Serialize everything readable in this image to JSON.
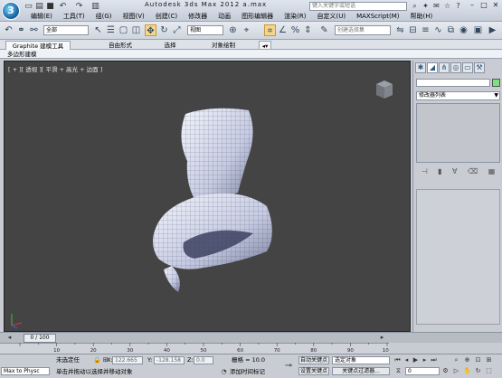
{
  "app": {
    "logo_glyph": "3",
    "title": "Autodesk 3ds Max  2012      a.max",
    "search_placeholder": "键入关键字或短语"
  },
  "menus": [
    "编辑(E)",
    "工具(T)",
    "组(G)",
    "视图(V)",
    "创建(C)",
    "修改器",
    "动画",
    "图形编辑器",
    "渲染(R)",
    "自定义(U)",
    "MAXScript(M)",
    "帮助(H)"
  ],
  "toolbar": {
    "selection_filter": "全部",
    "reference_coord": "视图",
    "named_selection": "创建选择集"
  },
  "ribbon": {
    "tabs": [
      "Graphite 建模工具",
      "自由形式",
      "选择",
      "对象绘制"
    ],
    "sub_label": "多边形建模"
  },
  "viewport": {
    "label": "[ + ][ 透视 ][ 平滑 + 高光 + 边面 ]"
  },
  "command_panel": {
    "modifier_list": "修改器列表"
  },
  "timeline": {
    "frame_counter": "0 / 100",
    "ticks": [
      "10",
      "20",
      "30",
      "40",
      "50",
      "60",
      "70",
      "80",
      "90",
      "100"
    ]
  },
  "status": {
    "max_to_physx": "Max to Physc",
    "selection_text": "未选定任",
    "prompt": "单击并拖动以选择并移动对象",
    "x_label": "X:",
    "x_value": "122.665",
    "y_label": "Y:",
    "y_value": "-128.158",
    "z_label": "Z:",
    "z_value": "0.0",
    "grid": "栅格 = 10.0",
    "add_time_tag": "添加时间标记",
    "auto_key": "自动关键点",
    "set_key": "设置关键点",
    "selected_object": "选定对象",
    "key_filters": "关键点过滤器...",
    "current_frame": "0"
  }
}
